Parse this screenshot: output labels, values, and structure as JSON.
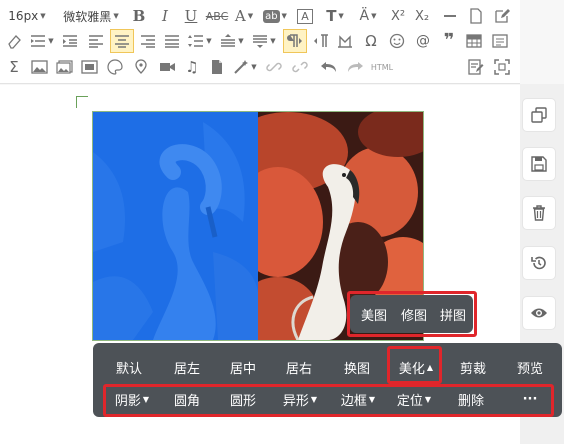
{
  "toolbar": {
    "font_size": "16px",
    "font_family": "微软雅黑",
    "html_label": "HTML"
  },
  "beautify_popup": {
    "items": [
      "美图",
      "修图",
      "拼图"
    ]
  },
  "image_toolbar": {
    "row1": [
      "默认",
      "居左",
      "居中",
      "居右",
      "换图",
      "美化",
      "剪裁",
      "预览"
    ],
    "row2": [
      "阴影",
      "圆角",
      "圆形",
      "异形",
      "边框",
      "定位",
      "删除",
      "···"
    ]
  },
  "colors": {
    "popup_bg": "#4d5257",
    "highlight": "#e0262b",
    "left_tint": "#1d6de6"
  }
}
